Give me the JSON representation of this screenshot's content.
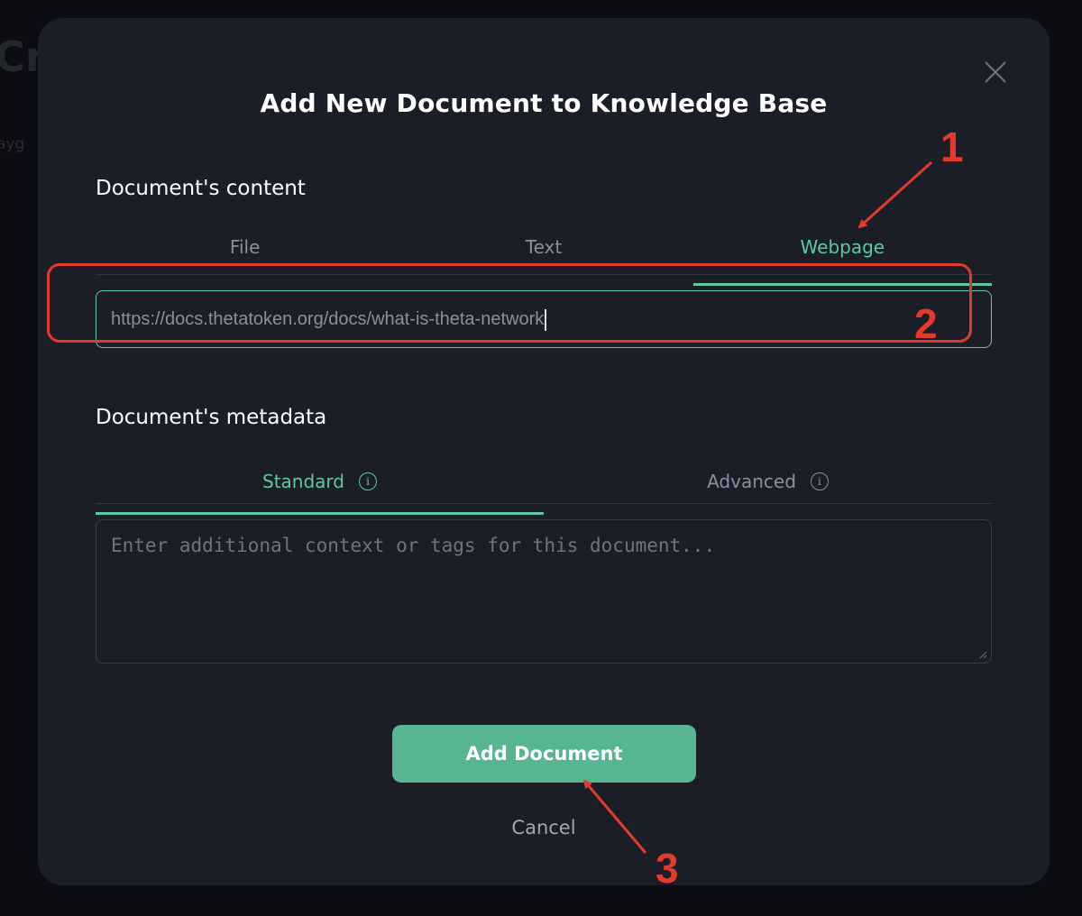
{
  "modal": {
    "title": "Add New Document to Knowledge Base",
    "content_section": {
      "title": "Document's content",
      "tabs": [
        {
          "label": "File",
          "active": false
        },
        {
          "label": "Text",
          "active": false
        },
        {
          "label": "Webpage",
          "active": true
        }
      ],
      "url_value": "https://docs.thetatoken.org/docs/what-is-theta-network"
    },
    "metadata_section": {
      "title": "Document's metadata",
      "tabs": [
        {
          "label": "Standard",
          "active": true
        },
        {
          "label": "Advanced",
          "active": false
        }
      ],
      "textarea_placeholder": "Enter additional context or tags for this document..."
    },
    "add_button_label": "Add Document",
    "cancel_label": "Cancel"
  },
  "annotations": {
    "labels": [
      "1",
      "2",
      "3"
    ],
    "color": "#e23b2e"
  },
  "colors": {
    "accent": "#5ec9a0",
    "button": "#58b591",
    "modal_bg": "#1c1e27",
    "page_bg": "#0c0d12"
  },
  "icons": [
    "close-icon",
    "info-icon"
  ]
}
